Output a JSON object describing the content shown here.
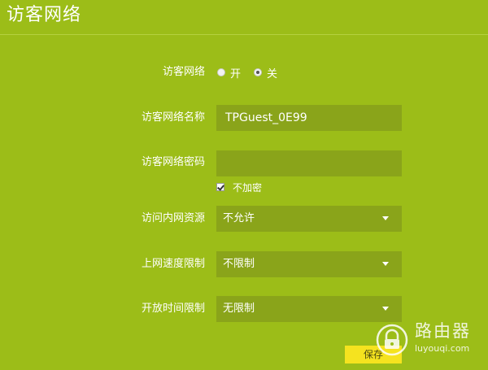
{
  "page": {
    "title": "访客网络"
  },
  "form": {
    "guest_network": {
      "label": "访客网络",
      "options": [
        "开",
        "关"
      ],
      "selected": "关"
    },
    "network_name": {
      "label": "访客网络名称",
      "value": "TPGuest_0E99"
    },
    "network_password": {
      "label": "访客网络密码",
      "value": "",
      "no_encryption_label": "不加密",
      "no_encryption_checked": true
    },
    "intranet_access": {
      "label": "访问内网资源",
      "value": "不允许"
    },
    "speed_limit": {
      "label": "上网速度限制",
      "value": "不限制"
    },
    "time_limit": {
      "label": "开放时间限制",
      "value": "无限制"
    },
    "save_label": "保存"
  },
  "watermark": {
    "title": "路由器",
    "url": "luyouqi.com",
    "icon": "router-lock-icon"
  },
  "colors": {
    "background": "#9cbd18",
    "field_background": "#8aa41a",
    "save_button": "#f5e31f"
  }
}
